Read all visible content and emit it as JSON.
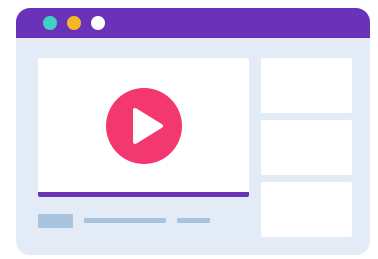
{
  "window": {
    "traffic_lights": [
      {
        "name": "dot-teal",
        "color": "#3fd0c4"
      },
      {
        "name": "dot-yellow",
        "color": "#f4b824"
      },
      {
        "name": "dot-white",
        "color": "#ffffff"
      }
    ],
    "titlebar_color": "#6a32b8"
  },
  "player": {
    "play_icon": "play-icon",
    "play_button_color": "#f2386f",
    "progress": 1.0,
    "progress_color": "#6a32b8"
  },
  "sidebar": {
    "thumbnails": 3
  },
  "colors": {
    "background": "#e3ebf6",
    "placeholder": "#a8c3de",
    "card": "#ffffff"
  }
}
